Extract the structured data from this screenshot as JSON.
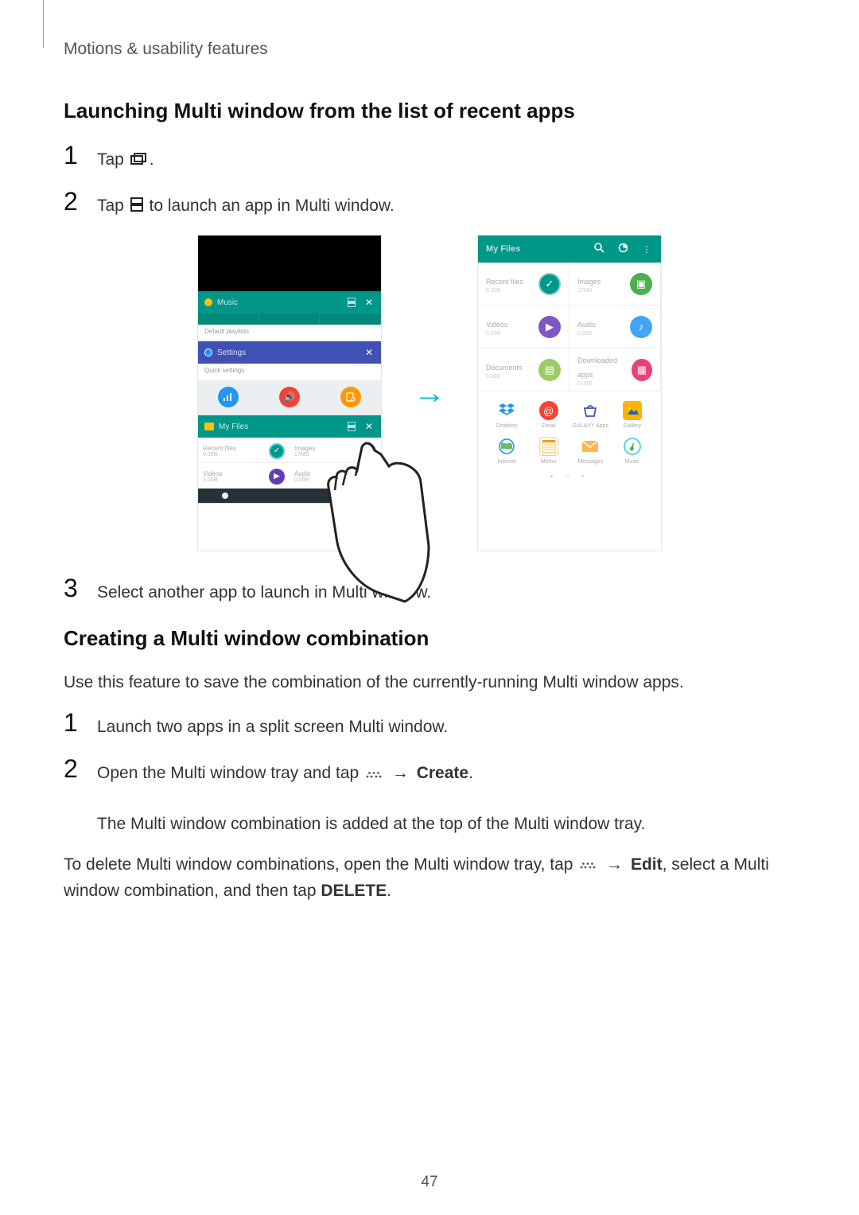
{
  "page_number": "47",
  "header": {
    "title": "Motions & usability features"
  },
  "section1": {
    "heading": "Launching Multi window from the list of recent apps",
    "step1": {
      "num": "1",
      "pre": "Tap ",
      "post": "."
    },
    "step2": {
      "num": "2",
      "pre": "Tap ",
      "post": " to launch an app in Multi window."
    },
    "step3": {
      "num": "3",
      "text": "Select another app to launch in Multi window."
    }
  },
  "section2": {
    "heading": "Creating a Multi window combination",
    "intro": "Use this feature to save the combination of the currently-running Multi window apps.",
    "step1": {
      "num": "1",
      "text": "Launch two apps in a split screen Multi window."
    },
    "step2": {
      "num": "2",
      "pre": "Open the Multi window tray and tap ",
      "arrow": "→",
      "create": "Create",
      "post": ".",
      "note": "The Multi window combination is added at the top of the Multi window tray."
    },
    "outro_pre": "To delete Multi window combinations, open the Multi window tray, tap ",
    "outro_arrow": "→",
    "outro_edit": "Edit",
    "outro_mid": ", select a Multi window combination, and then tap ",
    "outro_delete": "DELETE",
    "outro_post": "."
  },
  "figure": {
    "arrow": "→",
    "phone_left": {
      "music": {
        "title": "Music",
        "body": "Default playlists"
      },
      "settings": {
        "title": "Settings",
        "body": "Quick settings"
      },
      "files": {
        "title": "My Files",
        "recent": {
          "label": "Recent files",
          "sub": "0.00B"
        },
        "images": {
          "label": "Images",
          "sub": "17MB"
        },
        "videos": {
          "label": "Videos",
          "sub": "1.00B"
        },
        "audio": {
          "label": "Audio",
          "sub": "0.00B"
        }
      }
    },
    "phone_right": {
      "header": {
        "title": "My Files"
      },
      "cats": {
        "recent": {
          "label": "Recent files",
          "sub": "0.00B"
        },
        "images": {
          "label": "Images",
          "sub": "17MB"
        },
        "videos": {
          "label": "Videos",
          "sub": "0.00B"
        },
        "audio": {
          "label": "Audio",
          "sub": "0.00B"
        },
        "documents": {
          "label": "Documents",
          "sub": "0.00B"
        },
        "downloaded": {
          "label": "Downloaded apps",
          "sub": "0.00B"
        }
      },
      "apps": {
        "dropbox": "Dropbox",
        "email": "Email",
        "galaxy": "GALAXY Apps",
        "gallery": "Gallery",
        "internet": "Internet",
        "memo": "Memo",
        "messages": "Messages",
        "music": "Music"
      }
    }
  },
  "icons": {
    "recent_key": "recent-apps-icon",
    "multiwindow_key": "multiwindow-split-icon",
    "dots_key": "more-dots-icon"
  }
}
